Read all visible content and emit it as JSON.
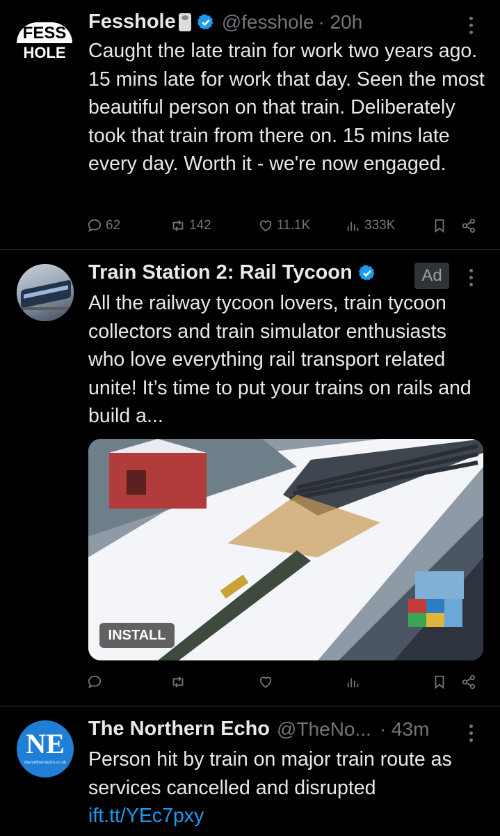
{
  "tweets": [
    {
      "name": "Fesshole",
      "handle": "@fesshole",
      "time": "· 20h",
      "avatar_text": [
        "FESS",
        "HOLE"
      ],
      "text": "Caught the late train for work two years ago. 15 mins late for work that day. Seen the most beautiful person on that train. Deliberately took that train from there on. 15 mins late every day. Worth it - we're now engaged.",
      "replies": "62",
      "retweets": "142",
      "likes": "11.1K",
      "views": "333K"
    },
    {
      "name": "Train Station 2: Rail Tycoon",
      "ad_label": "Ad",
      "text": "All the railway tycoon lovers, train tycoon collectors and train simulator enthusiasts who love everything rail transport related unite! It’s time to put your trains on rails and build a...",
      "install_label": "INSTALL"
    },
    {
      "name": "The Northern Echo",
      "handle": "@TheNo...",
      "time": "· 43m",
      "avatar_text": "NE",
      "avatar_subtext": "thenorthernecho.co.uk",
      "text": "Person hit by train on major train route as services cancelled and disrupted",
      "link": "ift.tt/YEc7pxy"
    }
  ],
  "colors": {
    "background": "#000000",
    "text": "#e7e9ea",
    "muted": "#71767b",
    "link": "#1d9bf0",
    "divider": "#2f3336"
  }
}
